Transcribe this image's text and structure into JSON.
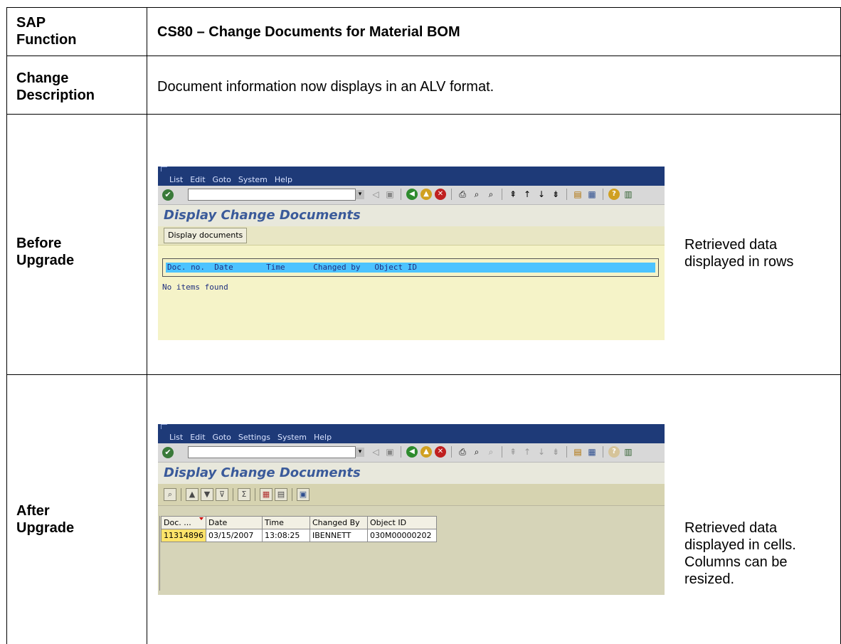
{
  "rows": [
    {
      "label": "SAP Function",
      "value": "CS80 – Change Documents for Material BOM"
    },
    {
      "label": "Change Description",
      "value": "Document information now displays in an ALV format."
    },
    {
      "label": "Before Upgrade",
      "note": "Retrieved data displayed in rows"
    },
    {
      "label": "After Upgrade",
      "note": "Retrieved data displayed in cells. Columns can be resized."
    }
  ],
  "labels": {
    "sap_function_l1": "SAP",
    "sap_function_l2": "Function",
    "change_desc_l1": "Change",
    "change_desc_l2": "Description",
    "before_l1": "Before",
    "before_l2": "Upgrade",
    "after_l1": "After",
    "after_l2": "Upgrade"
  },
  "notes": {
    "before_l1": "Retrieved data",
    "before_l2": "displayed in rows",
    "after_l1": "Retrieved data",
    "after_l2": "displayed in cells.",
    "after_l3": "Columns can be",
    "after_l4": "resized."
  },
  "before_screen": {
    "menu": [
      "List",
      "Edit",
      "Goto",
      "System",
      "Help"
    ],
    "title": "Display Change Documents",
    "button": "Display documents",
    "list_header": "Doc. no.  Date       Time      Changed by   Object ID",
    "empty_message": "No items found"
  },
  "after_screen": {
    "menu": [
      "List",
      "Edit",
      "Goto",
      "Settings",
      "System",
      "Help"
    ],
    "title": "Display Change Documents",
    "columns": [
      "Doc. ...",
      "Date",
      "Time",
      "Changed By",
      "Object ID"
    ],
    "row": [
      "11314896",
      "03/15/2007",
      "13:08:25",
      "IBENNETT",
      "030M00000202"
    ]
  },
  "icons": [
    "enter-check-icon",
    "back-icon",
    "exit-icon",
    "cancel-icon",
    "print-icon",
    "find-icon",
    "find-next-icon",
    "first-page-icon",
    "prev-page-icon",
    "next-page-icon",
    "last-page-icon",
    "new-session-icon",
    "shortcut-icon",
    "help-icon",
    "layout-icon"
  ],
  "colors": {
    "sap_titlebar": "#1e3a78",
    "title_text": "#3a5a9a",
    "list_header": "#4cc3ff",
    "cell_highlight": "#ffe36a"
  }
}
